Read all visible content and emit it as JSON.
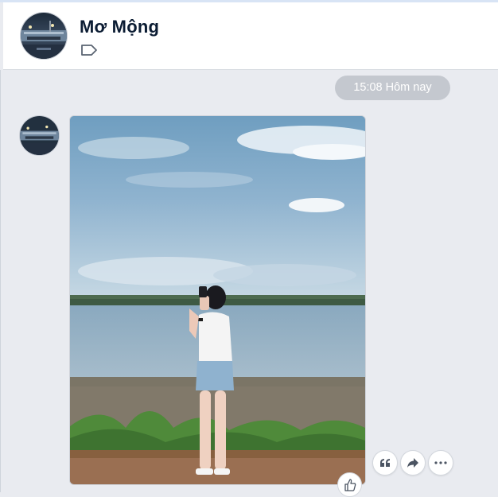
{
  "header": {
    "title": "Mơ Mộng",
    "avatar_icon": "avatar-night-city",
    "tag_icon": "tag-outline-icon"
  },
  "conversation": {
    "timestamp": "15:08 Hôm nay",
    "message": {
      "type": "photo",
      "sender_avatar_icon": "avatar-night-city",
      "image_description_icon": "photo-lake-girl"
    },
    "actions": [
      {
        "name": "quote",
        "icon": "quote-icon"
      },
      {
        "name": "forward",
        "icon": "forward-arrow-icon"
      },
      {
        "name": "more",
        "icon": "more-dots-icon"
      }
    ],
    "reaction": {
      "icon": "thumbs-up-icon"
    }
  },
  "colors": {
    "background": "#e9ebf0",
    "header_bg": "#ffffff",
    "pill_bg": "#c4c8cf",
    "title_text": "#0b1c33"
  }
}
